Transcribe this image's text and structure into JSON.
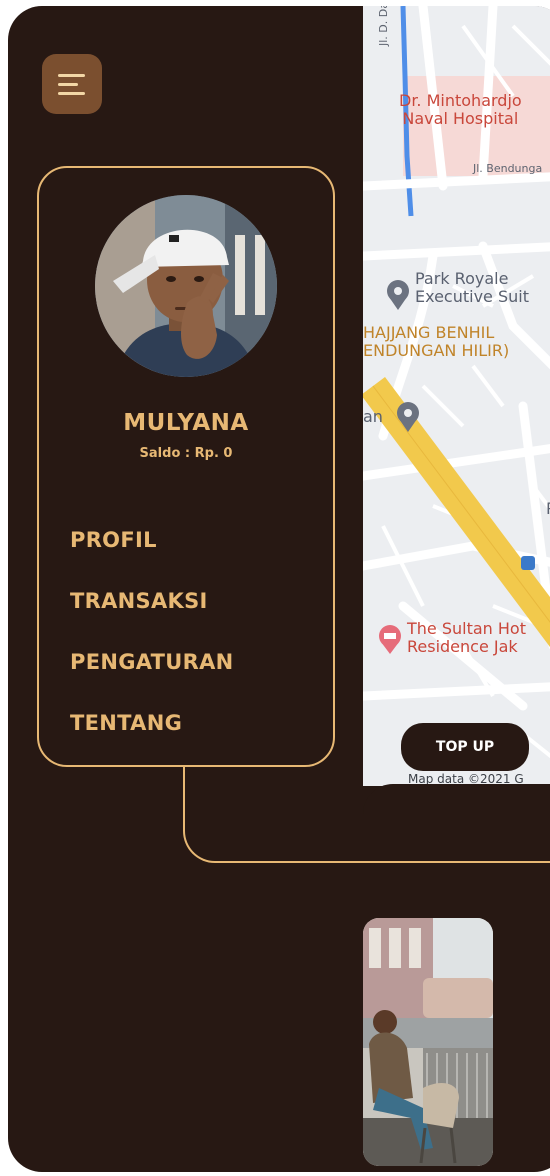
{
  "menu": {
    "icon": "hamburger-menu-icon"
  },
  "map": {
    "labels": {
      "road_top_vertical": "Jl. D. Dampe",
      "hospital": "Dr. Mintohardjo\nNaval Hospital",
      "road_bendungan": "Jl. Bendunga",
      "park_royale": "Park Royale\nExecutive Suit",
      "area": "HAJJANG BENHIL\nENDUNGAN HILIR)",
      "area_fragment": "an",
      "p_fragment": "P",
      "sultan": "The Sultan Hot\nResidence Jak"
    },
    "attribution": "Map data ©2021 G"
  },
  "profile": {
    "name": "MULYANA",
    "balance": "Saldo : Rp. 0"
  },
  "nav": {
    "items": [
      {
        "label": "PROFIL"
      },
      {
        "label": "TRANSAKSI"
      },
      {
        "label": "PENGATURAN"
      },
      {
        "label": "TENTANG"
      }
    ]
  },
  "actions": {
    "top_up": "TOP UP"
  },
  "colors": {
    "background": "#271813",
    "accent": "#e7b874",
    "menu_button": "#7b4f2f"
  }
}
